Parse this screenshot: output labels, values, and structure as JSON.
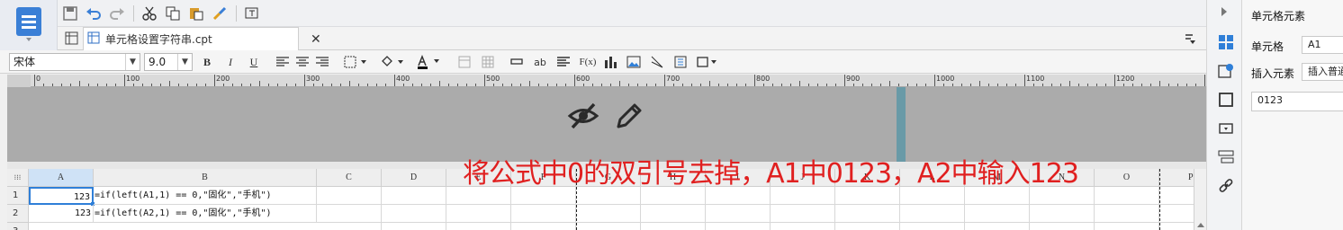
{
  "tab": {
    "title": "单元格设置字符串.cpt"
  },
  "toolbar": {
    "icons": [
      "save-icon",
      "undo-icon",
      "redo-icon",
      "cut-icon",
      "copy-icon",
      "paste-icon",
      "format-painter-icon",
      "insert-toolbar-icon"
    ]
  },
  "format": {
    "font_family": "宋体",
    "font_size": "9.0",
    "bold": "B",
    "italic": "I",
    "underline": "U",
    "wrap_label": "ab",
    "formula_label": "F(x)"
  },
  "ruler": {
    "labels": [
      "0",
      "100",
      "200",
      "300",
      "400",
      "500",
      "600",
      "700",
      "800",
      "900",
      "1000",
      "1100",
      "1200"
    ],
    "vertical_label": "0"
  },
  "sheet": {
    "columns": [
      "A",
      "B",
      "C",
      "D",
      "E",
      "F",
      "G",
      "H",
      "I",
      "J",
      "K",
      "L",
      "M",
      "N",
      "O",
      "P"
    ],
    "rows": [
      {
        "num": "1",
        "a": "123",
        "b": "=if(left(A1,1) == 0,\"固化\",\"手机\")"
      },
      {
        "num": "2",
        "a": "123",
        "b": "=if(left(A2,1) == 0,\"固化\",\"手机\")"
      },
      {
        "num": "3",
        "a": "",
        "b": ""
      }
    ]
  },
  "annotation": "将公式中0的双引号去掉，A1中0123，A2中输入123",
  "panel": {
    "title": "单元格元素",
    "cell_label": "单元格",
    "cell_value": "A1",
    "insert_label": "插入元素",
    "insert_value": "插入普通",
    "content_value": "0123"
  },
  "colors": {
    "accent": "#3a7fd6",
    "annotation": "#e02020",
    "selection": "#2f7fd8"
  }
}
